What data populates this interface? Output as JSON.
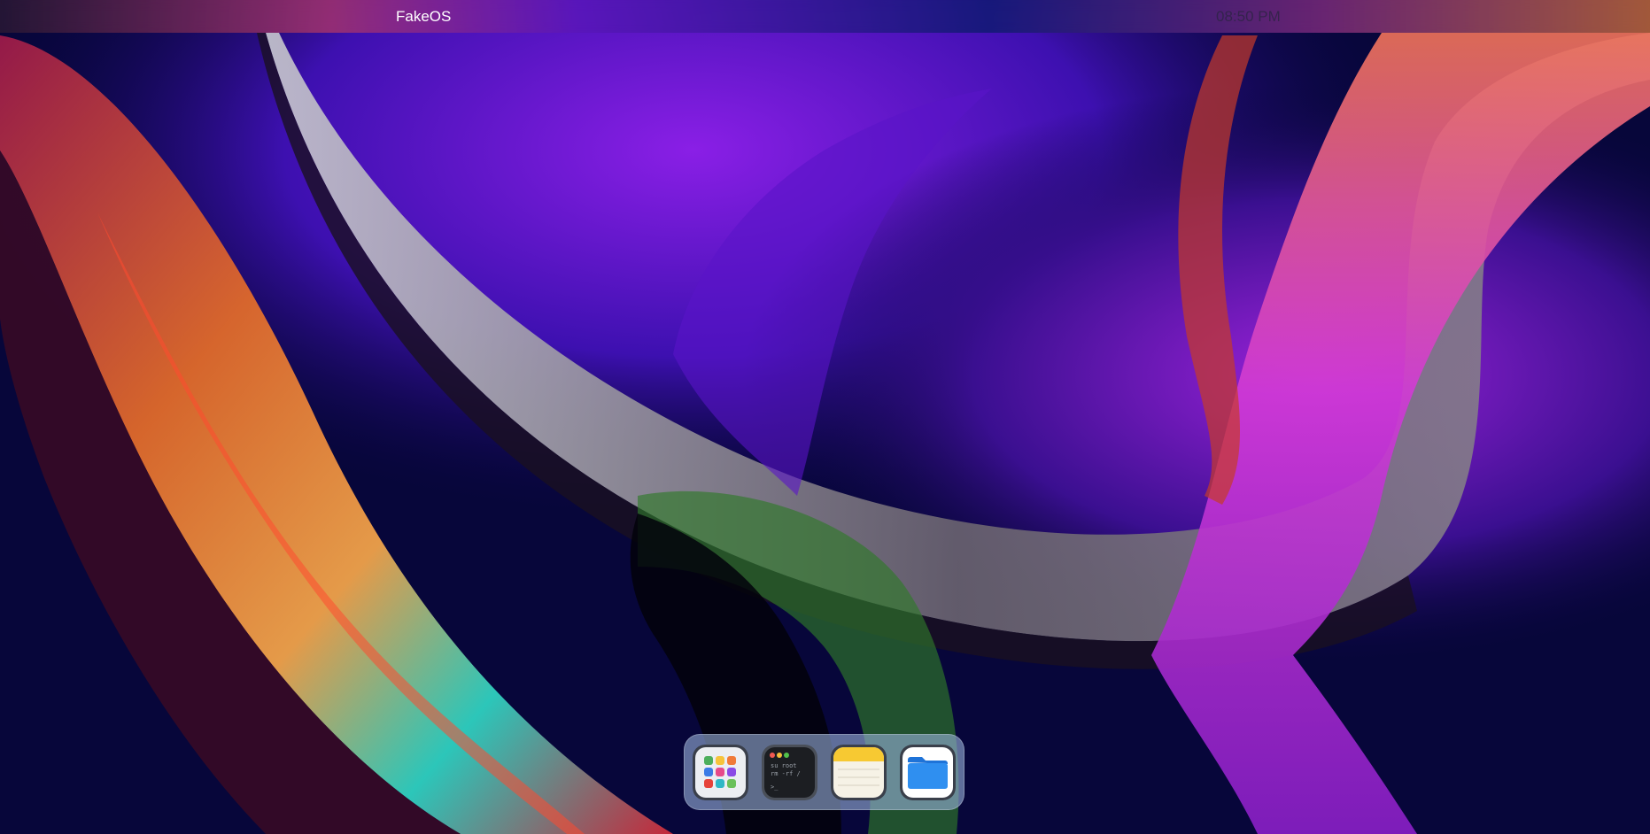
{
  "menubar": {
    "brand": "FakeOS",
    "clock": "08:50 PM"
  },
  "dock": {
    "items": [
      {
        "icon": "launchpad-icon"
      },
      {
        "icon": "terminal-icon",
        "line1": "su root",
        "line2": "rm -rf /",
        "prompt": ">_"
      },
      {
        "icon": "notes-icon"
      },
      {
        "icon": "files-icon"
      }
    ]
  },
  "colors": {
    "background": "#07063a",
    "dock": "#96afd7",
    "folder": "#2f8ff0",
    "notes_header": "#f7c932"
  }
}
